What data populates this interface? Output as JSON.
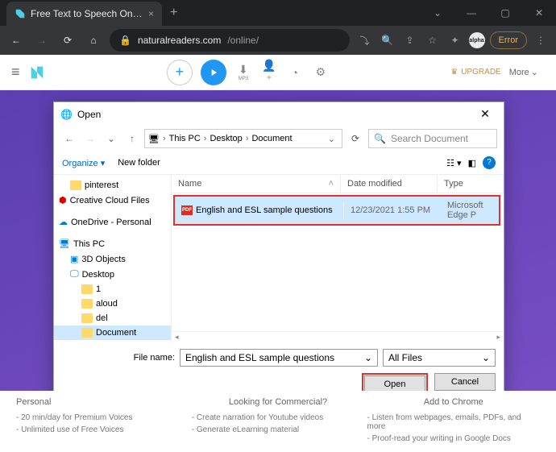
{
  "browser": {
    "tab_title": "Free Text to Speech Online with N",
    "url_domain": "naturalreaders.com",
    "url_path": "/online/",
    "error_label": "Error"
  },
  "header": {
    "upgrade_label": "UPGRADE",
    "more_label": "More",
    "icon_mp3_label": "MP3"
  },
  "dialog": {
    "title": "Open",
    "breadcrumb": [
      "This PC",
      "Desktop",
      "Document"
    ],
    "search_placeholder": "Search Document",
    "organize_label": "Organize",
    "newfolder_label": "New folder",
    "columns": {
      "name": "Name",
      "date": "Date modified",
      "type": "Type"
    },
    "tree": [
      {
        "label": "pinterest",
        "indent": 1,
        "icon": "folder"
      },
      {
        "label": "Creative Cloud Files",
        "indent": 0,
        "icon": "cc"
      },
      {
        "label": "OneDrive - Personal",
        "indent": 0,
        "icon": "onedrive"
      },
      {
        "label": "This PC",
        "indent": 0,
        "icon": "pc"
      },
      {
        "label": "3D Objects",
        "indent": 1,
        "icon": "3d"
      },
      {
        "label": "Desktop",
        "indent": 1,
        "icon": "desktop"
      },
      {
        "label": "1",
        "indent": 2,
        "icon": "folder"
      },
      {
        "label": "aloud",
        "indent": 2,
        "icon": "folder"
      },
      {
        "label": "del",
        "indent": 2,
        "icon": "folder"
      },
      {
        "label": "Document",
        "indent": 2,
        "icon": "folder",
        "selected": true
      }
    ],
    "file": {
      "name": "English and ESL sample questions",
      "date": "12/23/2021 1:55 PM",
      "type": "Microsoft Edge P"
    },
    "filename_label": "File name:",
    "filename_value": "English and ESL sample questions",
    "filter_value": "All Files",
    "open_label": "Open",
    "cancel_label": "Cancel"
  },
  "footer": {
    "col1_title": "Personal",
    "col1_items": [
      "- 20 min/day for Premium Voices",
      "- Unlimited use of Free Voices"
    ],
    "col2_title": "Looking for Commercial?",
    "col2_items": [
      "- Create narration for Youtube videos",
      "- Generate eLearning material"
    ],
    "col3_title": "Add to Chrome",
    "col3_items": [
      "- Listen from webpages, emails, PDFs, and more",
      "- Proof-read your writing in Google Docs"
    ]
  }
}
